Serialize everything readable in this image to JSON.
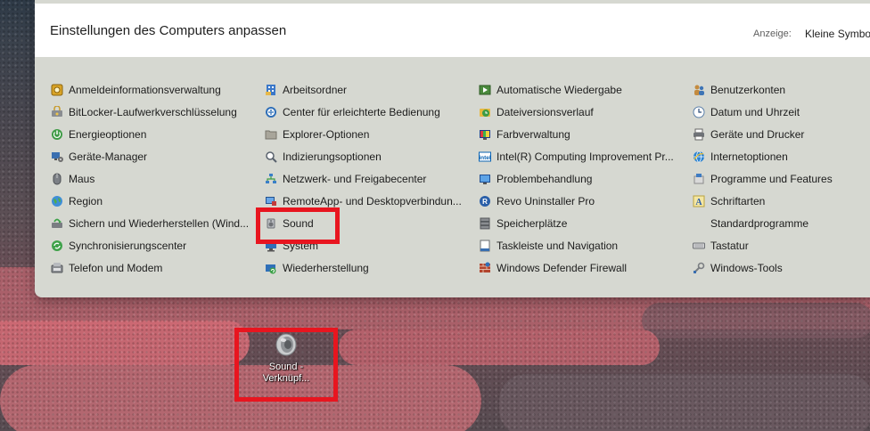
{
  "window": {
    "title": "Einstellungen des Computers anpassen",
    "view_label": "Anzeige:",
    "view_value": "Kleine Symbole"
  },
  "items": [
    {
      "label": "Anmeldeinformationsverwaltung",
      "icon": "credential-vault-icon"
    },
    {
      "label": "Arbeitsordner",
      "icon": "work-folders-icon"
    },
    {
      "label": "Automatische Wiedergabe",
      "icon": "autoplay-icon"
    },
    {
      "label": "Benutzerkonten",
      "icon": "user-accounts-icon"
    },
    {
      "label": "BitLocker-Laufwerkverschlüsselung",
      "icon": "bitlocker-icon"
    },
    {
      "label": "Center für erleichterte Bedienung",
      "icon": "ease-of-access-icon"
    },
    {
      "label": "Dateiversionsverlauf",
      "icon": "file-history-icon"
    },
    {
      "label": "Datum und Uhrzeit",
      "icon": "clock-icon"
    },
    {
      "label": "Energieoptionen",
      "icon": "power-icon"
    },
    {
      "label": "Explorer-Optionen",
      "icon": "folder-icon"
    },
    {
      "label": "Farbverwaltung",
      "icon": "color-management-icon"
    },
    {
      "label": "Geräte und Drucker",
      "icon": "printer-icon"
    },
    {
      "label": "Geräte-Manager",
      "icon": "device-manager-icon"
    },
    {
      "label": "Indizierungsoptionen",
      "icon": "indexing-icon"
    },
    {
      "label": "Intel(R) Computing Improvement Pr...",
      "icon": "intel-icon"
    },
    {
      "label": "Internetoptionen",
      "icon": "internet-options-icon"
    },
    {
      "label": "Maus",
      "icon": "mouse-icon"
    },
    {
      "label": "Netzwerk- und Freigabecenter",
      "icon": "network-icon"
    },
    {
      "label": "Problembehandlung",
      "icon": "troubleshooting-icon"
    },
    {
      "label": "Programme und Features",
      "icon": "programs-icon"
    },
    {
      "label": "Region",
      "icon": "globe-icon"
    },
    {
      "label": "RemoteApp- und Desktopverbindun...",
      "icon": "remote-desktop-icon"
    },
    {
      "label": "Revo Uninstaller Pro",
      "icon": "revo-uninstaller-icon"
    },
    {
      "label": "Schriftarten",
      "icon": "fonts-icon"
    },
    {
      "label": "Sichern und Wiederherstellen (Wind...",
      "icon": "backup-icon"
    },
    {
      "label": "Sound",
      "icon": "speaker-icon"
    },
    {
      "label": "Speicherplätze",
      "icon": "storage-spaces-icon"
    },
    {
      "label": "Standardprogramme",
      "icon": "default-programs-icon"
    },
    {
      "label": "Synchronisierungscenter",
      "icon": "sync-icon"
    },
    {
      "label": "System",
      "icon": "system-icon"
    },
    {
      "label": "Taskleiste und Navigation",
      "icon": "taskbar-icon"
    },
    {
      "label": "Tastatur",
      "icon": "keyboard-icon"
    },
    {
      "label": "Telefon und Modem",
      "icon": "phone-modem-icon"
    },
    {
      "label": "Wiederherstellung",
      "icon": "recovery-icon"
    },
    {
      "label": "Windows Defender Firewall",
      "icon": "firewall-icon"
    },
    {
      "label": "Windows-Tools",
      "icon": "windows-tools-icon"
    }
  ],
  "desktop": {
    "shortcut_line1": "Sound -",
    "shortcut_line2": "Verknüpf...",
    "shortcut_icon": "speaker-icon"
  },
  "colors": {
    "highlight": "#e8151f",
    "panel_bg": "#d6d8d1",
    "header_bg": "#ffffff"
  }
}
